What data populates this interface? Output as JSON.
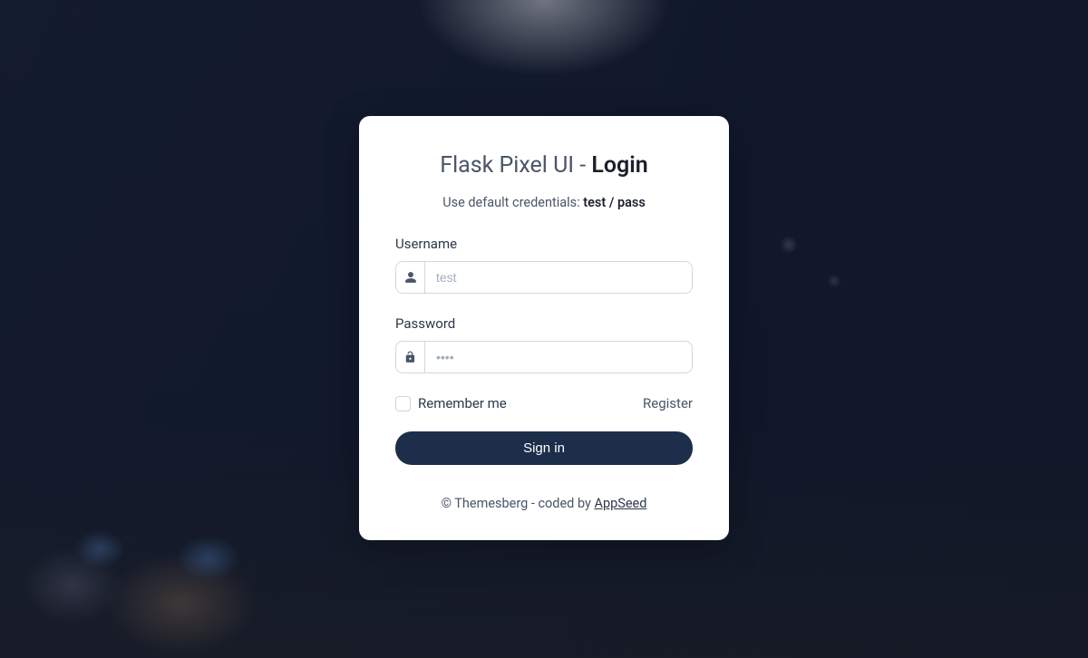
{
  "title": {
    "prefix": "Flask Pixel UI - ",
    "bold": "Login"
  },
  "subtitle": {
    "prefix": "Use default credentials: ",
    "bold": "test / pass"
  },
  "form": {
    "username_label": "Username",
    "username_placeholder": "test",
    "username_value": "",
    "password_label": "Password",
    "password_placeholder": "••••",
    "password_value": "",
    "remember_label": "Remember me",
    "register_label": "Register",
    "submit_label": "Sign in"
  },
  "footer": {
    "prefix": "© Themesberg - coded by ",
    "link": "AppSeed"
  },
  "colors": {
    "card_bg": "#ffffff",
    "primary": "#1c2e4a",
    "text": "#2d3748",
    "muted": "#4a5568"
  }
}
